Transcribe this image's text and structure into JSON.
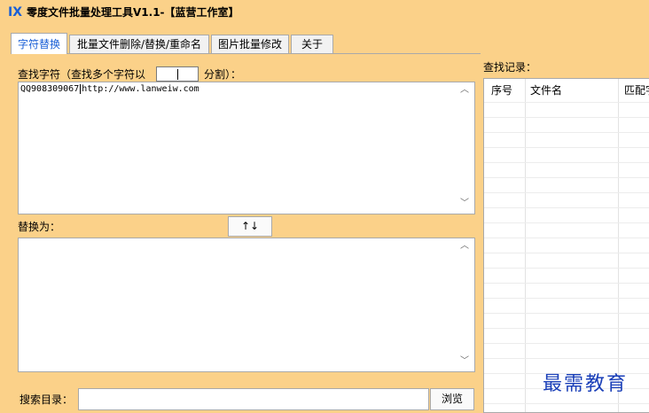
{
  "window": {
    "title": "零度文件批量处理工具V1.1-【蓝营工作室】",
    "logo_icon": "ix-logo-icon"
  },
  "tabs": [
    {
      "label": "字符替换",
      "active": true
    },
    {
      "label": "批量文件删除/替换/重命名",
      "active": false
    },
    {
      "label": "图片批量修改",
      "active": false
    },
    {
      "label": "关于",
      "active": false
    }
  ],
  "find": {
    "label": "查找字符（查找多个字符以",
    "separator_value": "",
    "split_label": "分割）：",
    "value_part1": "QQ908309067",
    "value_part2": "http://www.lanweiw.com"
  },
  "replace": {
    "label": "替换为：",
    "value": "",
    "swap_label": "↑↓"
  },
  "directory": {
    "label": "搜索目录：",
    "value": "",
    "browse_label": "浏览"
  },
  "results": {
    "label": "查找记录：",
    "columns": [
      "序号",
      "文件名",
      "匹配字"
    ]
  },
  "watermark": "最需教育",
  "colors": {
    "background": "#fbd189",
    "accent": "#1a5fd6",
    "watermark": "#1a3fb8"
  }
}
